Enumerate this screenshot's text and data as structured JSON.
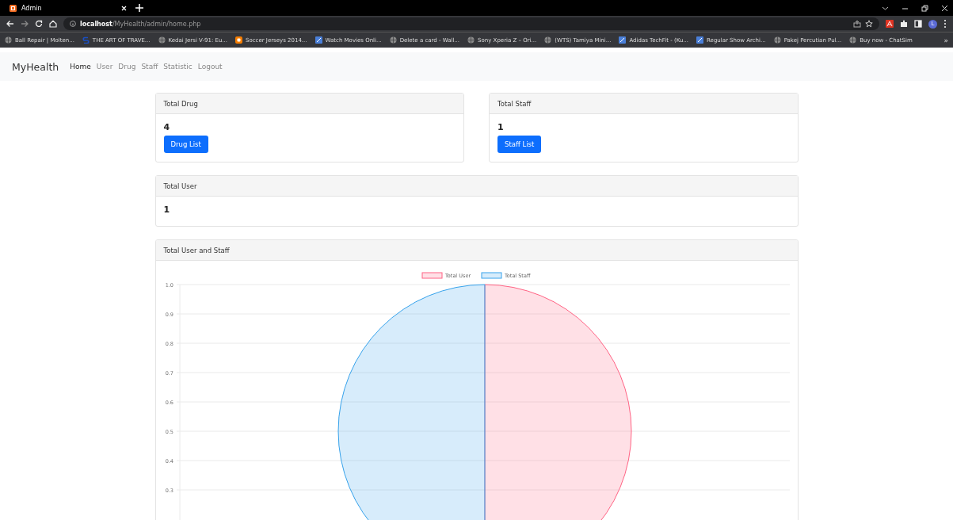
{
  "browser": {
    "tab": {
      "title": "Admin"
    },
    "url": {
      "host": "localhost",
      "path": "/MyHealth/admin/home.php"
    },
    "bookmarks": [
      {
        "title": "Ball Repair | Molten...",
        "kind": "globe"
      },
      {
        "title": "THE ART OF TRAVE...",
        "kind": "letter"
      },
      {
        "title": "Kedai Jersi V-91: Eu...",
        "kind": "globe"
      },
      {
        "title": "Soccer Jerseys 2014...",
        "kind": "blog"
      },
      {
        "title": "Watch Movies Onli...",
        "kind": "tile"
      },
      {
        "title": "Delete a card - Wall...",
        "kind": "globe"
      },
      {
        "title": "Sony Xperia Z – Ori...",
        "kind": "globe"
      },
      {
        "title": "(WTS) Tamiya Mini...",
        "kind": "globe"
      },
      {
        "title": "Adidas TechFit - (Ku...",
        "kind": "tile"
      },
      {
        "title": "Regular Show Archi...",
        "kind": "tile"
      },
      {
        "title": "Pakej Percutian Pul...",
        "kind": "globe"
      },
      {
        "title": "Buy now - ChatSim",
        "kind": "globe"
      }
    ],
    "more": "»",
    "profile": "L"
  },
  "navbar": {
    "brand": "MyHealth",
    "items": [
      {
        "label": "Home",
        "selected": true
      },
      {
        "label": "User",
        "selected": false
      },
      {
        "label": "Drug",
        "selected": false
      },
      {
        "label": "Staff",
        "selected": false
      },
      {
        "label": "Statistic",
        "selected": false
      },
      {
        "label": "Logout",
        "selected": false
      }
    ]
  },
  "cards": [
    {
      "title": "Total Drug",
      "value": "4",
      "button": "Drug List"
    },
    {
      "title": "Total Staff",
      "value": "1",
      "button": "Staff List"
    },
    {
      "title": "Total User",
      "value": "1"
    }
  ],
  "chart_card": {
    "title": "Total User and Staff",
    "chart_data": {
      "type": "pie",
      "categories": [
        "Total User",
        "Total Staff"
      ],
      "values": [
        50,
        50
      ],
      "legend": "top",
      "colors": [
        "#ff6384",
        "#36a2eb"
      ]
    },
    "axis_labels": [
      "1.0",
      "0.9",
      "0.8",
      "0.7",
      "0.6",
      "0.5",
      "0.4",
      "0.3"
    ]
  }
}
